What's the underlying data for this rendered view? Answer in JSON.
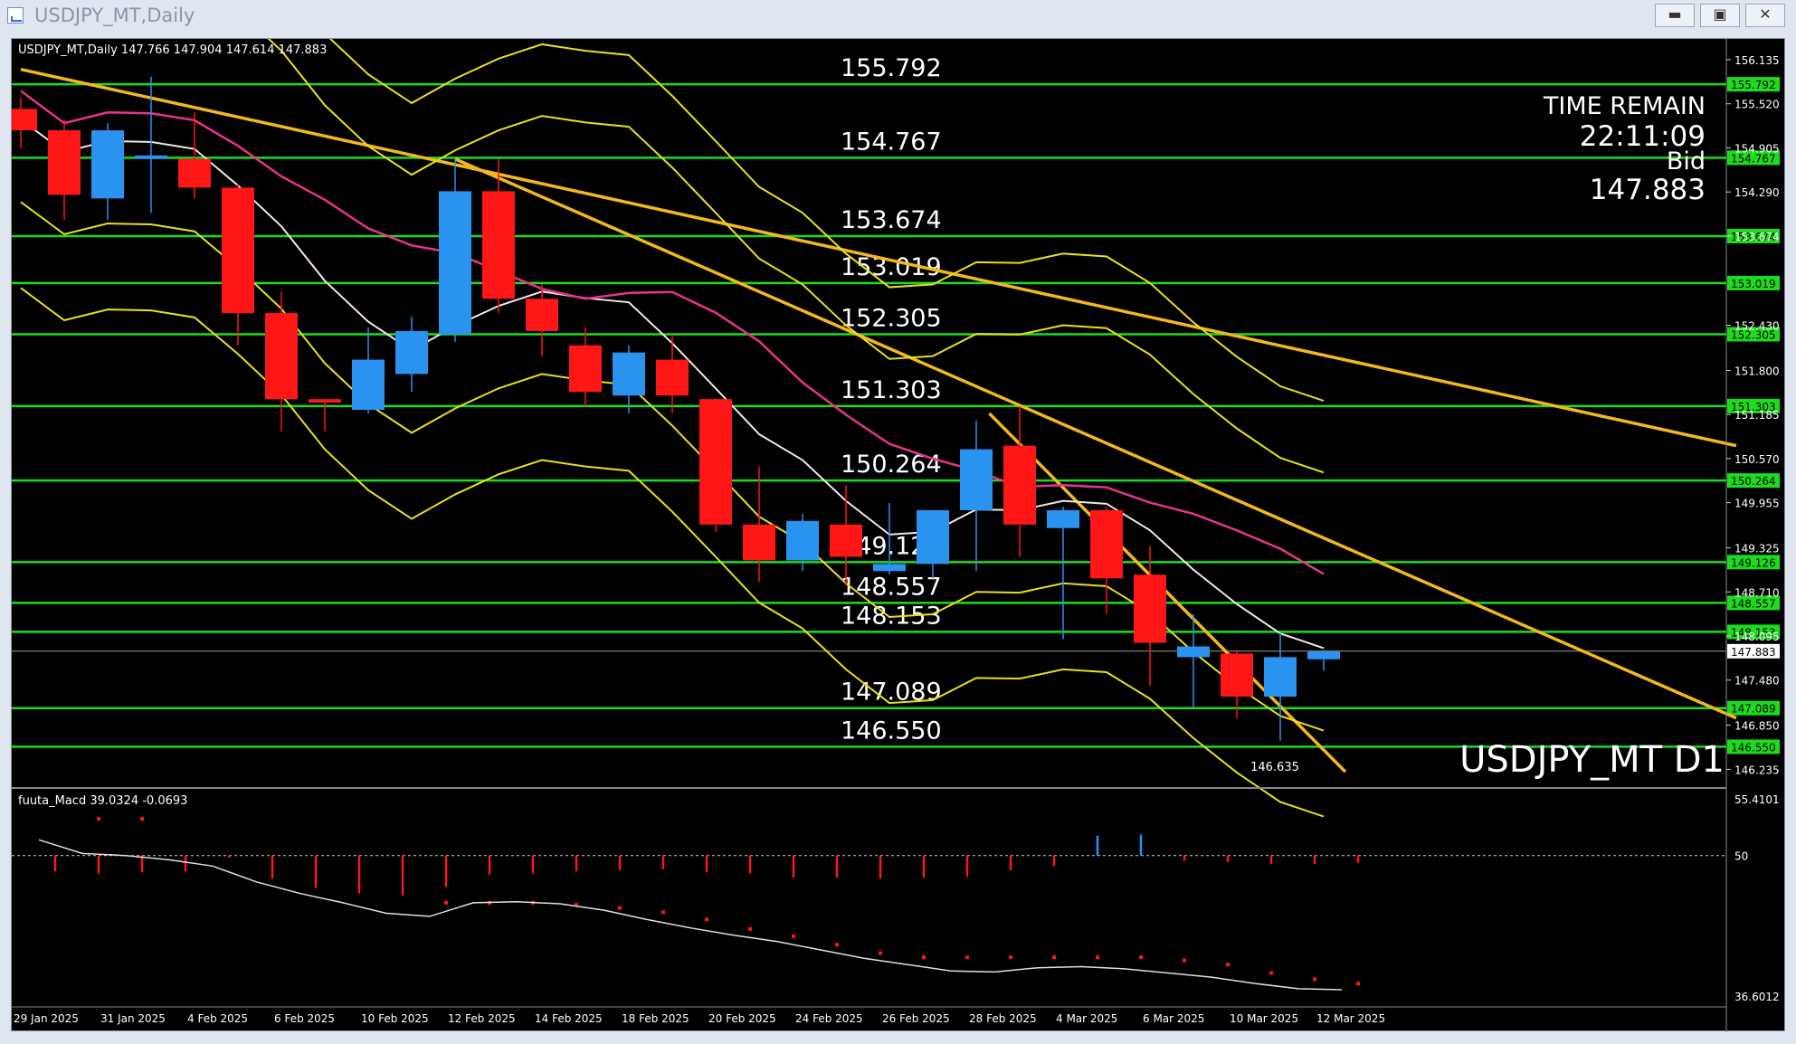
{
  "window": {
    "title": "USDJPY_MT,Daily"
  },
  "titlebar_buttons": [
    {
      "name": "minimize-button",
      "glyph": "▬"
    },
    {
      "name": "restore-button",
      "glyph": "▣"
    },
    {
      "name": "close-button",
      "glyph": "✕"
    }
  ],
  "chart_header": "USDJPY_MT,Daily  147.766 147.904 147.614 147.883",
  "symbol_label": "USDJPY_MT D1",
  "timer": {
    "label": "TIME REMAIN",
    "value": "22:11:09",
    "bid_label": "Bid",
    "bid_value": "147.883"
  },
  "colors": {
    "background": "#000000",
    "bull": "#2a93f0",
    "bear": "#ff1616",
    "level_line": "#1ddc1d",
    "trend_line": "#f2b81e",
    "band": "#e8e01a",
    "ma_white": "#f5e6e6",
    "ma_pink": "#e8348a",
    "price_axis_text": "#ffffff"
  },
  "lower_low_label": "146.635",
  "chart_data": {
    "type": "candlestick",
    "price_range": [
      146.0,
      156.4
    ],
    "price_ticks": [
      "156.135",
      "155.520",
      "154.905",
      "154.290",
      "153.674",
      "152.430",
      "151.800",
      "151.185",
      "150.570",
      "149.955",
      "149.325",
      "148.710",
      "148.095",
      "147.480",
      "146.850",
      "146.235"
    ],
    "date_labels": [
      "29 Jan 2025",
      "31 Jan 2025",
      "4 Feb 2025",
      "6 Feb 2025",
      "10 Feb 2025",
      "12 Feb 2025",
      "14 Feb 2025",
      "18 Feb 2025",
      "20 Feb 2025",
      "24 Feb 2025",
      "26 Feb 2025",
      "28 Feb 2025",
      "4 Mar 2025",
      "6 Mar 2025",
      "10 Mar 2025",
      "12 Mar 2025"
    ],
    "levels": [
      "155.792",
      "154.767",
      "153.674",
      "153.019",
      "152.305",
      "151.303",
      "150.264",
      "149.126",
      "148.557",
      "148.153",
      "147.089",
      "146.550"
    ],
    "current_price": "147.883",
    "candles": [
      {
        "o": 155.45,
        "h": 155.6,
        "l": 154.9,
        "c": 155.15
      },
      {
        "o": 155.15,
        "h": 155.3,
        "l": 153.9,
        "c": 154.25
      },
      {
        "o": 154.2,
        "h": 155.25,
        "l": 153.9,
        "c": 155.15
      },
      {
        "o": 154.75,
        "h": 155.9,
        "l": 154.0,
        "c": 154.8
      },
      {
        "o": 154.75,
        "h": 155.4,
        "l": 154.2,
        "c": 154.35
      },
      {
        "o": 154.35,
        "h": 154.4,
        "l": 152.15,
        "c": 152.6
      },
      {
        "o": 152.6,
        "h": 152.9,
        "l": 150.95,
        "c": 151.4
      },
      {
        "o": 151.4,
        "h": 151.4,
        "l": 150.95,
        "c": 151.35
      },
      {
        "o": 151.25,
        "h": 152.4,
        "l": 151.2,
        "c": 151.95
      },
      {
        "o": 151.75,
        "h": 152.55,
        "l": 151.5,
        "c": 152.35
      },
      {
        "o": 152.3,
        "h": 154.75,
        "l": 152.2,
        "c": 154.3
      },
      {
        "o": 154.3,
        "h": 154.75,
        "l": 152.6,
        "c": 152.8
      },
      {
        "o": 152.8,
        "h": 153.0,
        "l": 152.0,
        "c": 152.35
      },
      {
        "o": 152.15,
        "h": 152.4,
        "l": 151.3,
        "c": 151.5
      },
      {
        "o": 151.45,
        "h": 152.15,
        "l": 151.2,
        "c": 152.05
      },
      {
        "o": 151.95,
        "h": 152.3,
        "l": 151.2,
        "c": 151.45
      },
      {
        "o": 151.4,
        "h": 151.4,
        "l": 149.55,
        "c": 149.65
      },
      {
        "o": 149.65,
        "h": 150.45,
        "l": 148.85,
        "c": 149.15
      },
      {
        "o": 149.15,
        "h": 149.8,
        "l": 149.0,
        "c": 149.7
      },
      {
        "o": 149.65,
        "h": 150.2,
        "l": 148.8,
        "c": 149.2
      },
      {
        "o": 149.0,
        "h": 149.95,
        "l": 148.95,
        "c": 149.1
      },
      {
        "o": 149.1,
        "h": 149.85,
        "l": 148.9,
        "c": 149.85
      },
      {
        "o": 149.85,
        "h": 151.1,
        "l": 149.0,
        "c": 150.7
      },
      {
        "o": 150.75,
        "h": 151.3,
        "l": 149.2,
        "c": 149.65
      },
      {
        "o": 149.6,
        "h": 149.9,
        "l": 148.05,
        "c": 149.85
      },
      {
        "o": 149.85,
        "h": 149.9,
        "l": 148.4,
        "c": 148.9
      },
      {
        "o": 148.95,
        "h": 149.35,
        "l": 147.4,
        "c": 148.0
      },
      {
        "o": 147.8,
        "h": 148.4,
        "l": 147.1,
        "c": 147.95
      },
      {
        "o": 147.85,
        "h": 147.9,
        "l": 146.95,
        "c": 147.25
      },
      {
        "o": 147.25,
        "h": 148.15,
        "l": 146.635,
        "c": 147.8
      },
      {
        "o": 147.77,
        "h": 147.9,
        "l": 147.61,
        "c": 147.88
      }
    ],
    "indicator": {
      "name": "fuuta_Macd",
      "header": "fuuta_Macd 39.0324  -0.0693",
      "range": [
        36.6012,
        55.4101
      ],
      "ticks": [
        "55.4101",
        "50",
        "36.6012"
      ],
      "midline": 50,
      "histogram": [
        48.5,
        48.3,
        48.4,
        48.5,
        49.8,
        47.8,
        46.9,
        46.4,
        46.2,
        47.0,
        48.2,
        48.3,
        48.5,
        48.6,
        48.7,
        48.4,
        48.3,
        47.9,
        47.9,
        47.8,
        47.9,
        48.0,
        48.6,
        49.0,
        51.9,
        52.0,
        49.5,
        49.4,
        49.2,
        49.2,
        49.3
      ],
      "signal_dots": [
        null,
        53.5,
        53.5,
        null,
        null,
        null,
        null,
        null,
        null,
        45.5,
        45.5,
        45.5,
        45.3,
        45.0,
        44.6,
        43.9,
        43.0,
        42.3,
        41.5,
        40.7,
        40.3,
        40.3,
        40.3,
        40.3,
        40.3,
        40.3,
        40.0,
        39.6,
        38.8,
        38.2,
        37.8
      ],
      "line": [
        51.5,
        50.2,
        50.0,
        49.6,
        49.0,
        47.5,
        46.4,
        45.5,
        44.5,
        44.2,
        45.5,
        45.6,
        45.4,
        44.8,
        43.9,
        43.1,
        42.4,
        41.8,
        41.0,
        40.2,
        39.6,
        39.0,
        38.9,
        39.3,
        39.4,
        39.2,
        38.8,
        38.4,
        37.8,
        37.3,
        37.2
      ]
    }
  }
}
